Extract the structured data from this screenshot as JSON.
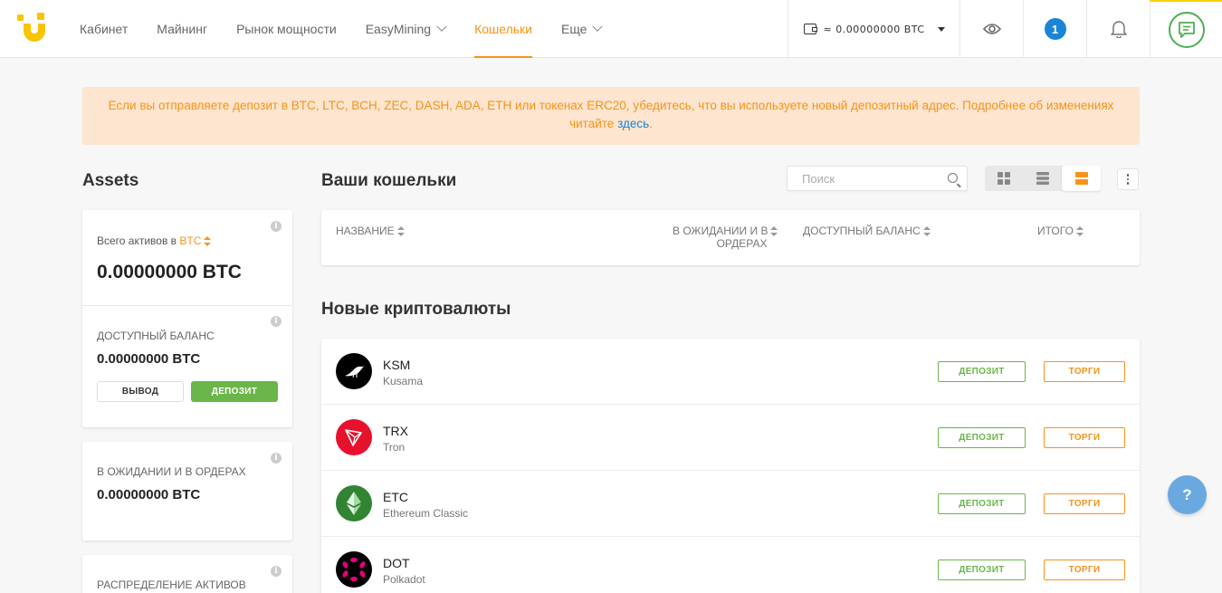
{
  "nav": {
    "items": [
      {
        "label": "Кабинет",
        "dropdown": false,
        "active": false
      },
      {
        "label": "Майнинг",
        "dropdown": false,
        "active": false
      },
      {
        "label": "Рынок мощности",
        "dropdown": false,
        "active": false
      },
      {
        "label": "EasyMining",
        "dropdown": true,
        "active": false
      },
      {
        "label": "Кошельки",
        "dropdown": false,
        "active": true
      },
      {
        "label": "Еще",
        "dropdown": true,
        "active": false
      }
    ]
  },
  "topbar": {
    "balance": "≈ 0.00000000 BTC",
    "notifications_count": "1"
  },
  "notice": {
    "text": "Если вы отправляете депозит в BTC, LTC, BCH, ZEC, DASH, ADA, ETH или токенах ERC20, убедитесь, что вы используете новый депозитный адрес. Подробнее об изменениях читайте ",
    "link": "здесь",
    "suffix": "."
  },
  "assets": {
    "title": "Assets",
    "total_label_prefix": "Всего активов в ",
    "total_currency": "BTC",
    "total_value": "0.00000000 BTC",
    "available_label": "ДОСТУПНЫЙ БАЛАНС",
    "available_value": "0.00000000 BTC",
    "withdraw_label": "ВЫВОД",
    "deposit_label": "ДЕПОЗИТ",
    "pending_label": "В ОЖИДАНИИ И В ОРДЕРАХ",
    "pending_value": "0.00000000 BTC",
    "distribution_label": "РАСПРЕДЕЛЕНИЕ АКТИВОВ"
  },
  "wallets": {
    "title": "Ваши кошельки",
    "search_placeholder": "Поиск",
    "columns": {
      "name": "НАЗВАНИЕ",
      "pending_line1": "В ОЖИДАНИИ И В",
      "pending_line2": "ОРДЕРАХ",
      "available": "ДОСТУПНЫЙ БАЛАНС",
      "total": "ИТОГО"
    }
  },
  "new_crypto": {
    "title": "Новые криптовалюты",
    "deposit_label": "ДЕПОЗИТ",
    "trade_label": "ТОРГИ",
    "coins": [
      {
        "symbol": "KSM",
        "name": "Kusama",
        "icon": "kusama-bird-icon",
        "color": "#000000"
      },
      {
        "symbol": "TRX",
        "name": "Tron",
        "icon": "tron-triangle-icon",
        "color": "#e8112d"
      },
      {
        "symbol": "ETC",
        "name": "Ethereum Classic",
        "icon": "ethereum-classic-icon",
        "color": "#328332"
      },
      {
        "symbol": "DOT",
        "name": "Polkadot",
        "icon": "polkadot-dots-icon",
        "color": "#000000"
      }
    ]
  },
  "help": {
    "label": "?"
  },
  "colors": {
    "accent": "#f7931a",
    "green": "#6bb64a",
    "blue": "#1a85d6",
    "notice_bg": "#fde5cf"
  }
}
